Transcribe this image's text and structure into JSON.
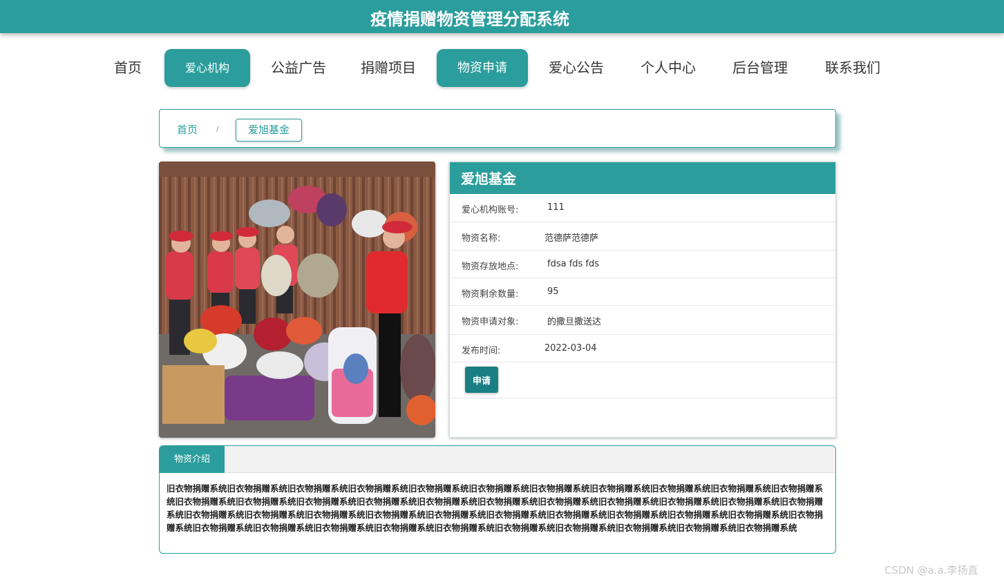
{
  "header": {
    "title": "疫情捐赠物资管理分配系统"
  },
  "nav": [
    {
      "label": "首页",
      "active": false
    },
    {
      "label": "爱心机构",
      "active": true
    },
    {
      "label": "公益广告",
      "active": false
    },
    {
      "label": "捐赠项目",
      "active": false
    },
    {
      "label": "物资申请",
      "active": true
    },
    {
      "label": "爱心公告",
      "active": false
    },
    {
      "label": "个人中心",
      "active": false
    },
    {
      "label": "后台管理",
      "active": false
    },
    {
      "label": "联系我们",
      "active": false
    }
  ],
  "breadcrumb": {
    "home": "首页",
    "separator": "/",
    "current": "爱旭基金"
  },
  "detail": {
    "title": "爱旭基金",
    "rows": [
      {
        "label": "爱心机构账号:",
        "value": "111"
      },
      {
        "label": "物资名称:",
        "value": "范德萨范德萨"
      },
      {
        "label": "物资存放地点:",
        "value": "fdsa fds fds"
      },
      {
        "label": "物资剩余数量:",
        "value": "95"
      },
      {
        "label": "物资申请对象:",
        "value": "的撒旦撒送达"
      },
      {
        "label": "发布时间:",
        "value": "2022-03-04"
      }
    ],
    "apply_label": "申请"
  },
  "intro": {
    "tab_label": "物资介绍",
    "text": "旧衣物捐赠系统旧衣物捐赠系统旧衣物捐赠系统旧衣物捐赠系统旧衣物捐赠系统旧衣物捐赠系统旧衣物捐赠系统旧衣物捐赠系统旧衣物捐赠系统旧衣物捐赠系统旧衣物捐赠系统旧衣物捐赠系统旧衣物捐赠系统旧衣物捐赠系统旧衣物捐赠系统旧衣物捐赠系统旧衣物捐赠系统旧衣物捐赠系统旧衣物捐赠系统旧衣物捐赠系统旧衣物捐赠系统旧衣物捐赠系统旧衣物捐赠系统旧衣物捐赠系统旧衣物捐赠系统旧衣物捐赠系统旧衣物捐赠系统旧衣物捐赠系统旧衣物捐赠系统旧衣物捐赠系统旧衣物捐赠系统旧衣物捐赠系统旧衣物捐赠系统旧衣物捐赠系统旧衣物捐赠系统旧衣物捐赠系统旧衣物捐赠系统旧衣物捐赠系统旧衣物捐赠系统旧衣物捐赠系统旧衣物捐赠系统旧衣物捐赠系统旧衣物捐赠系统"
  },
  "watermark": "CSDN @a.a.李扬直",
  "colors": {
    "primary": "#2a9d9c",
    "button": "#1a7f83"
  }
}
